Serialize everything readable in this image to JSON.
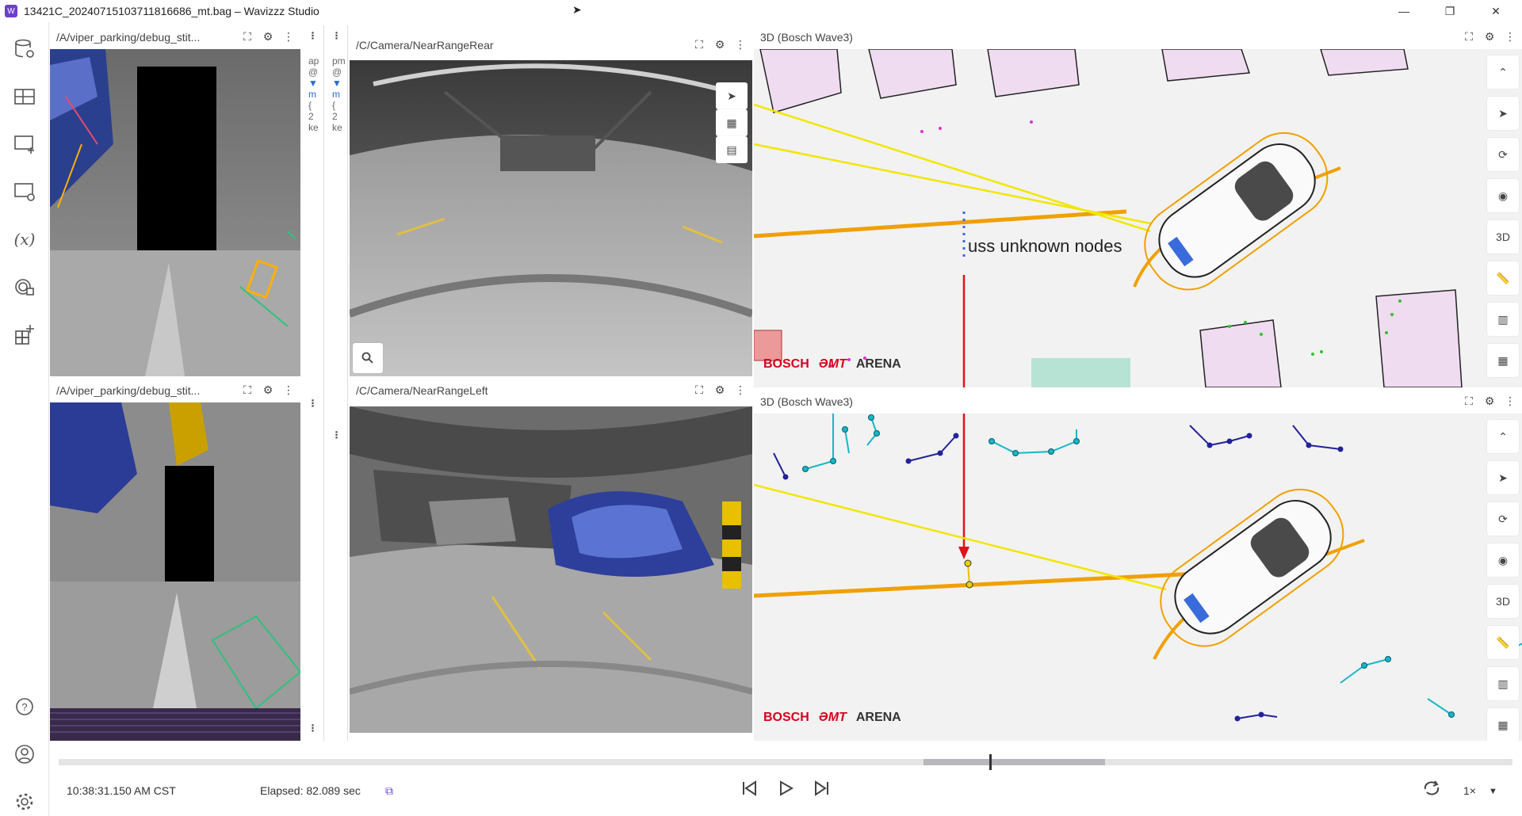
{
  "title_bar": {
    "window_title": "13421C_20240715103711816686_mt.bag – Wavizzz Studio",
    "minimize": "—",
    "maximize": "❐",
    "close": "✕"
  },
  "sidebar": {
    "items": [
      {
        "icon": "database-settings-icon"
      },
      {
        "icon": "layout-icon"
      },
      {
        "icon": "add-panel-icon"
      },
      {
        "icon": "panel-settings-icon"
      },
      {
        "icon": "variables-icon",
        "glyph": "(x)"
      },
      {
        "icon": "extensions-icon"
      },
      {
        "icon": "layout-add-icon"
      }
    ],
    "bottom": [
      {
        "icon": "help-icon"
      },
      {
        "icon": "account-icon"
      },
      {
        "icon": "settings-icon"
      }
    ]
  },
  "panels": {
    "debug_top": {
      "title": "/A/viper_parking/debug_stit..."
    },
    "debug_bottom": {
      "title": "/A/viper_parking/debug_stit..."
    },
    "rear": {
      "title": "/C/Camera/NearRangeRear"
    },
    "left": {
      "title": "/C/Camera/NearRangeLeft"
    },
    "three_d_top": {
      "title": "3D (Bosch Wave3)"
    },
    "three_d_bottom": {
      "title": "3D (Bosch Wave3)"
    }
  },
  "narrow_col1": {
    "lines": [
      "ap",
      "@",
      "▼",
      "m",
      "{",
      "2",
      "ke"
    ]
  },
  "narrow_col2": {
    "lines": [
      "pm",
      "@",
      "▼",
      "m",
      "{",
      "2",
      "ke"
    ]
  },
  "annotation": {
    "text": "uss unknown nodes",
    "color": "#e2101a"
  },
  "logos": {
    "bosch": "BOSCH",
    "mt": "ƏMT",
    "arena": "ARENA"
  },
  "rail_buttons": {
    "three_d": "3D"
  },
  "playback": {
    "time": "10:38:31.150 AM CST",
    "elapsed": "Elapsed: 82.089 sec",
    "speed": "1×",
    "progress": 0.64,
    "buffer_start": 0.595,
    "buffer_end": 0.72
  },
  "colors": {
    "accent": "#6c3fd0",
    "yellow_line": "#f2e600",
    "orange_path": "#f0a000",
    "red_arrow": "#e2101a"
  }
}
